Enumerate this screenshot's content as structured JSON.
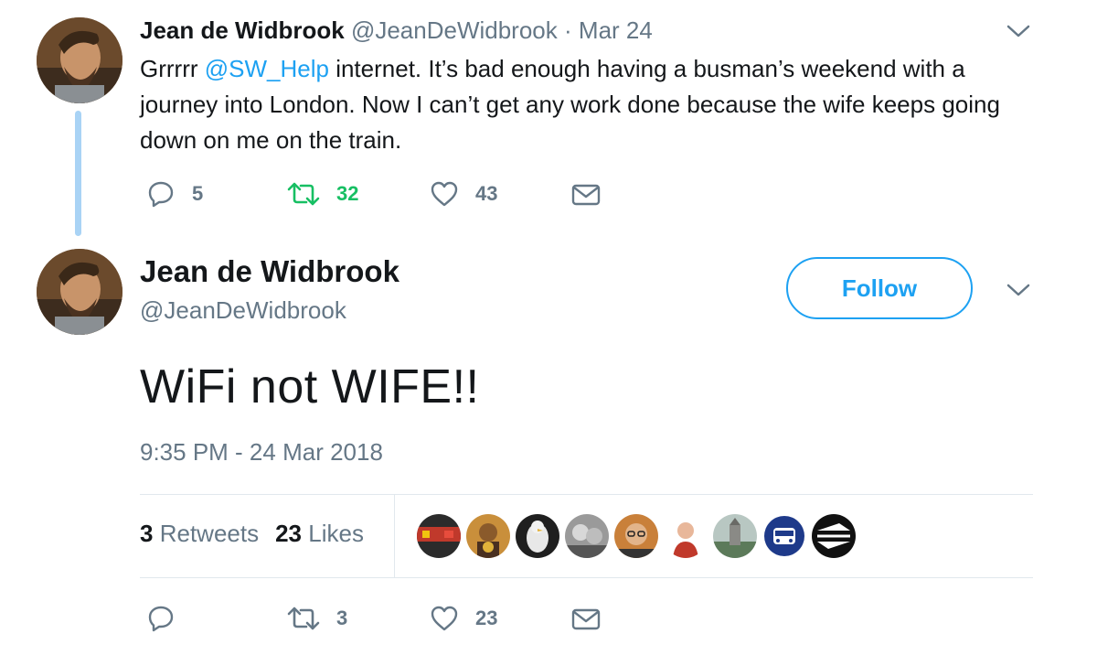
{
  "reply_to_tweet": {
    "author_name": "Jean de Widbrook",
    "handle": "@JeanDeWidbrook",
    "separator": "·",
    "date": "Mar 24",
    "text_before_mention": "Grrrrr ",
    "mention": "@SW_Help",
    "text_after_mention": " internet. It’s bad enough having a busman’s weekend with a journey into London. Now I can’t get any work done because the wife keeps going down on me on the train.",
    "reply_count": "5",
    "retweet_count": "32",
    "like_count": "43"
  },
  "main_tweet": {
    "author_name": "Jean de Widbrook",
    "handle": "@JeanDeWidbrook",
    "follow_label": "Follow",
    "text": "WiFi not WIFE!!",
    "timestamp": "9:35 PM - 24 Mar 2018",
    "stats": {
      "retweets_num": "3",
      "retweets_label": "Retweets",
      "likes_num": "23",
      "likes_label": "Likes"
    },
    "actions": {
      "retweet_count": "3",
      "like_count": "23"
    },
    "liker_avatar_count": 9
  },
  "colors": {
    "accent": "#1da1f2",
    "retweet_green": "#17bf63",
    "muted": "#657786",
    "text": "#14171a",
    "thread_line": "#a9d3f5",
    "divider": "#e1e8ed"
  },
  "icons": [
    "chevron-down-icon",
    "reply-icon",
    "retweet-icon",
    "heart-icon",
    "envelope-icon"
  ]
}
